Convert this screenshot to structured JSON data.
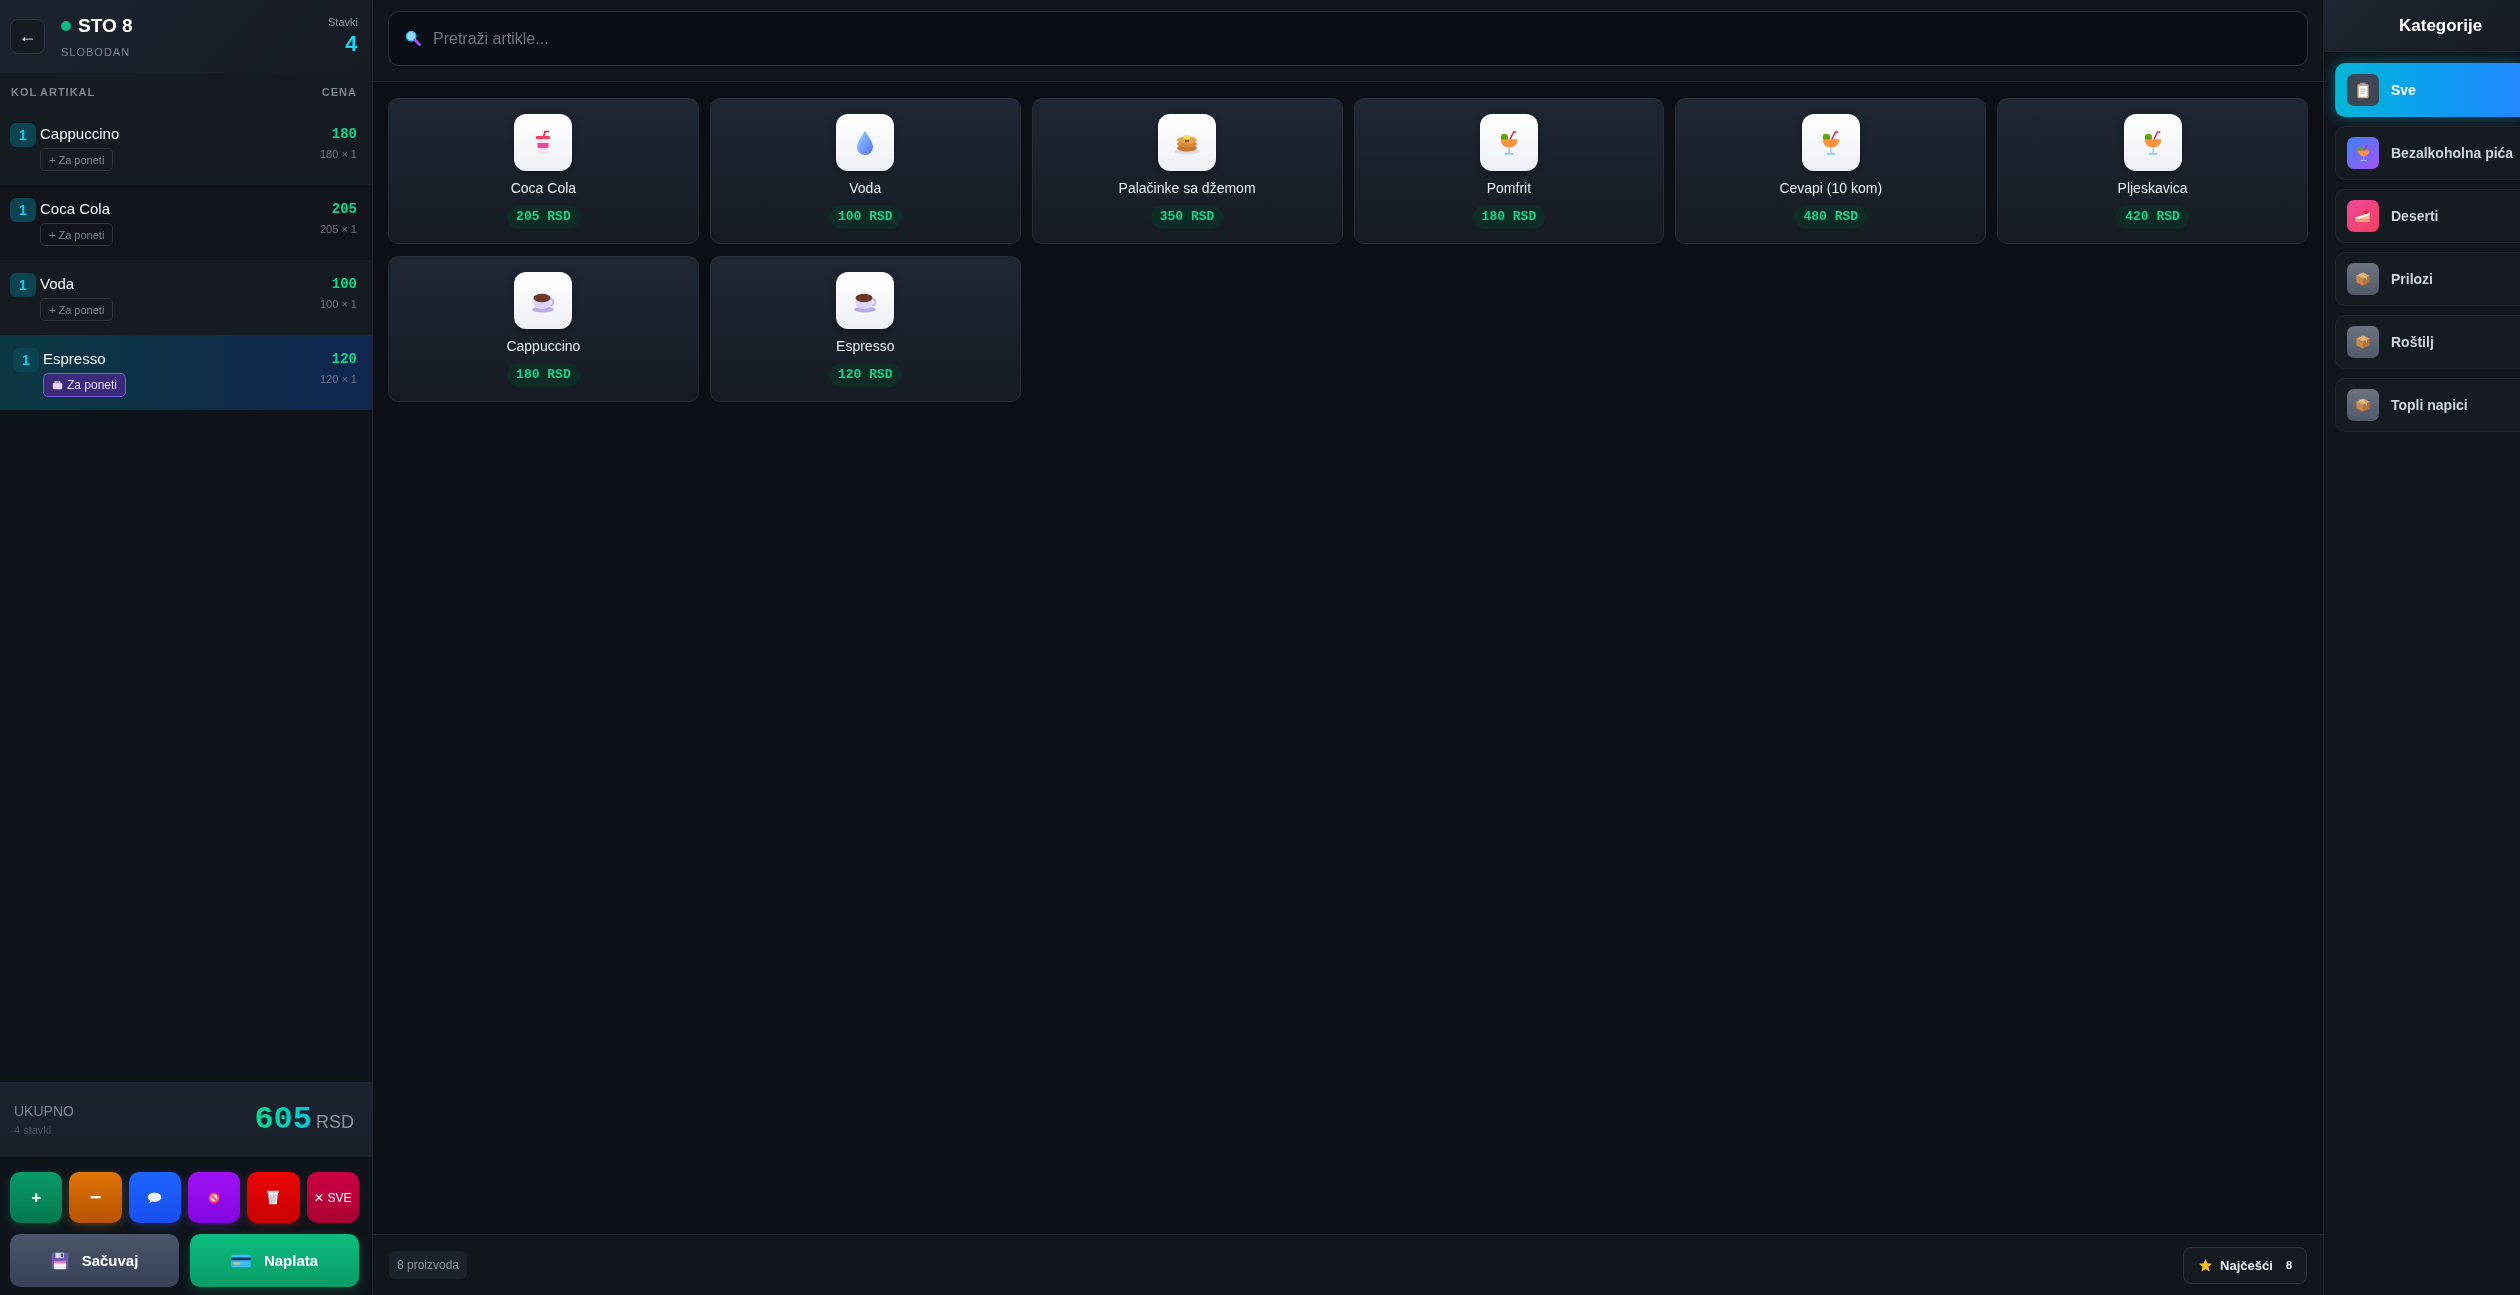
{
  "order": {
    "back_label": "←",
    "table": "STO 8",
    "status": "SLOBODAN",
    "items_label": "Stavki",
    "items_count": "4",
    "columns": [
      "KOL",
      "ARTIKAL",
      "CENA"
    ],
    "items": [
      {
        "qty": "1",
        "name": "Cappuccino",
        "takeaway_label": "+ Za poneti",
        "takeaway": false,
        "price": "180",
        "calc": "180 × 1",
        "selected": false
      },
      {
        "qty": "1",
        "name": "Coca Cola",
        "takeaway_label": "+ Za poneti",
        "takeaway": false,
        "price": "205",
        "calc": "205 × 1",
        "selected": false
      },
      {
        "qty": "1",
        "name": "Voda",
        "takeaway_label": "+ Za poneti",
        "takeaway": false,
        "price": "100",
        "calc": "100 × 1",
        "selected": false
      },
      {
        "qty": "1",
        "name": "Espresso",
        "takeaway_label": "Za poneti",
        "takeaway": true,
        "price": "120",
        "calc": "120 × 1",
        "selected": true
      }
    ],
    "total": {
      "label": "UKUPNO",
      "count": "4 stavki",
      "amount": "605",
      "currency": "RSD"
    },
    "actions": [
      {
        "kind": "add",
        "label": "+"
      },
      {
        "kind": "remove",
        "label": "−"
      },
      {
        "kind": "note"
      },
      {
        "kind": "void"
      },
      {
        "kind": "delete"
      },
      {
        "kind": "clear",
        "label": "✕ SVE"
      }
    ],
    "buttons": [
      {
        "kind": "save",
        "label": "Sačuvaj"
      },
      {
        "kind": "pay",
        "label": "Naplata"
      }
    ]
  },
  "search": {
    "placeholder": "Pretraži artikle..."
  },
  "products": [
    {
      "name": "Coca Cola",
      "price": "205 RSD",
      "kind": "soda"
    },
    {
      "name": "Voda",
      "price": "100 RSD",
      "kind": "water"
    },
    {
      "name": "Palačinke sa džemom",
      "price": "350 RSD",
      "kind": "pancake"
    },
    {
      "name": "Pomfrit",
      "price": "180 RSD",
      "kind": "cocktail"
    },
    {
      "name": "Cevapi (10 kom)",
      "price": "480 RSD",
      "kind": "cocktail"
    },
    {
      "name": "Pljeskavica",
      "price": "420 RSD",
      "kind": "cocktail"
    },
    {
      "name": "Cappuccino",
      "price": "180 RSD",
      "kind": "coffee"
    },
    {
      "name": "Espresso",
      "price": "120 RSD",
      "kind": "coffee"
    }
  ],
  "footer": {
    "count": "8 proizvoda",
    "favorites": {
      "label": "Najčešći",
      "count": "8"
    }
  },
  "categories": {
    "title": "Kategorije",
    "items": [
      {
        "label": "Sve",
        "kind": "clipboard",
        "selected": true
      },
      {
        "label": "Bezalkoholna pića",
        "kind": "cocktail",
        "selected": false
      },
      {
        "label": "Deserti",
        "kind": "cake",
        "selected": false
      },
      {
        "label": "Prilozi",
        "kind": "box",
        "selected": false
      },
      {
        "label": "Roštilj",
        "kind": "box",
        "selected": false
      },
      {
        "label": "Topli napici",
        "kind": "box",
        "selected": false
      }
    ]
  }
}
